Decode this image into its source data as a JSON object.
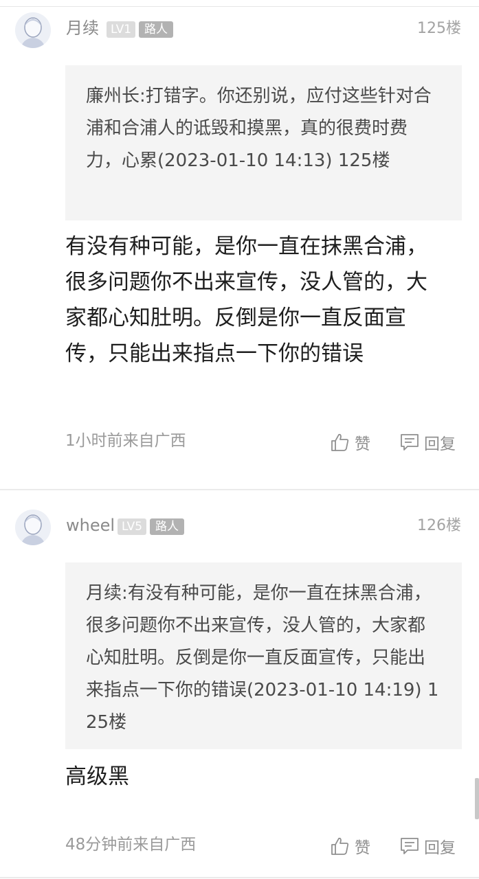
{
  "comments": [
    {
      "username": "月续",
      "level": "LV1",
      "role": "路人",
      "floor": "125楼",
      "quote": "廉州长:打错字。你还别说，应付这些针对合浦和合浦人的诋毁和摸黑，真的很费时费力，心累(2023-01-10 14:13)  125楼",
      "text": "有没有种可能，是你一直在抹黑合浦，很多问题你不出来宣传，没人管的，大家都心知肚明。反倒是你一直反面宣传，只能出来指点一下你的错误",
      "meta": "1小时前来自广西",
      "like_label": "赞",
      "reply_label": "回复"
    },
    {
      "username": "wheel",
      "level": "LV5",
      "role": "路人",
      "floor": "126楼",
      "quote": "月续:有没有种可能，是你一直在抹黑合浦，很多问题你不出来宣传，没人管的，大家都心知肚明。反倒是你一直反面宣传，只能出来指点一下你的错误(2023-01-10 14:19)  125楼",
      "text": "高级黑",
      "meta": "48分钟前来自广西",
      "like_label": "赞",
      "reply_label": "回复"
    }
  ]
}
